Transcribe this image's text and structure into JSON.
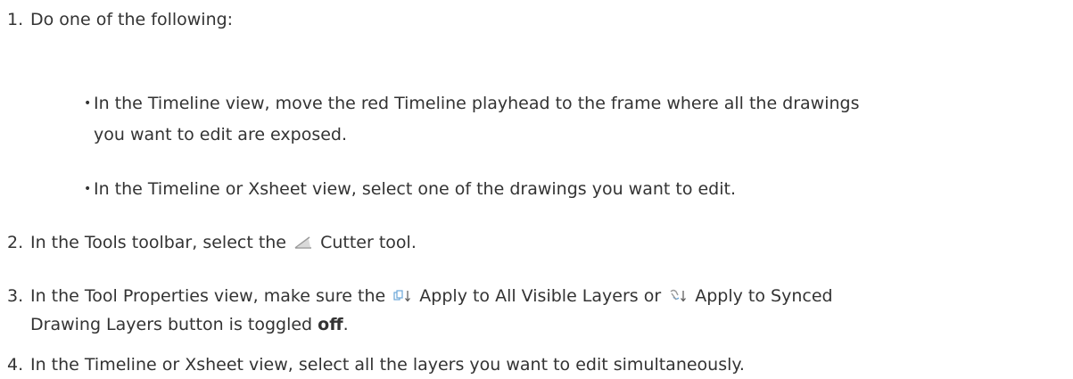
{
  "steps": [
    {
      "number": "1.",
      "text": "Do one of the following:",
      "bullets": [
        "In the Timeline view, move the red Timeline playhead to the frame where all the drawings",
        "you want to edit are exposed.",
        "In the Timeline or Xsheet view, select one of the drawings you want to edit."
      ]
    },
    {
      "number": "2.",
      "text_before": "In the Tools toolbar, select the",
      "text_after": "Cutter tool.",
      "icon": "cutter-icon"
    },
    {
      "number": "3.",
      "text_before": "In the Tool Properties view, make sure the",
      "text_middle": "Apply to All Visible Layers or",
      "text_after": "Apply to Synced",
      "line2_before": "Drawing Layers button is toggled",
      "line2_bold": "off",
      "line2_after": ".",
      "icons": [
        "apply-to-all-visible-layers-icon",
        "apply-to-synced-drawing-layers-icon"
      ]
    },
    {
      "number": "4.",
      "text": "In the Timeline or Xsheet view, select all the layers you want to edit simultaneously."
    }
  ],
  "colors": {
    "text": "#333333",
    "icon_blue": "#6aa6d8",
    "icon_gray": "#9a9a9a"
  }
}
